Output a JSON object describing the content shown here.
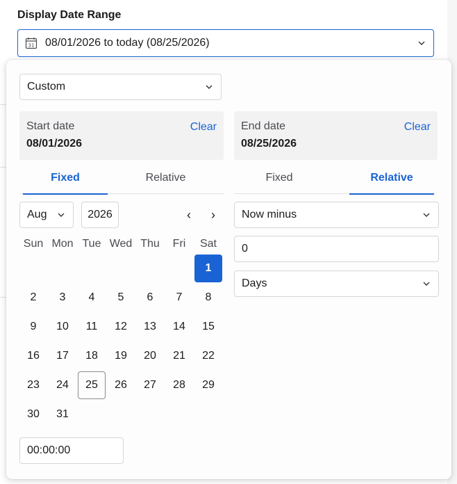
{
  "field": {
    "title": "Display Date Range",
    "value": "08/01/2026 to today (08/25/2026)",
    "calendar_icon_text": "31"
  },
  "preset": {
    "selected": "Custom"
  },
  "start": {
    "caption": "Start date",
    "value": "08/01/2026",
    "clear_label": "Clear",
    "tabs": [
      {
        "label": "Fixed",
        "active": true
      },
      {
        "label": "Relative",
        "active": false
      }
    ],
    "month_select": "Aug",
    "year_input": "2026",
    "weekdays": [
      "Sun",
      "Mon",
      "Tue",
      "Wed",
      "Thu",
      "Fri",
      "Sat"
    ],
    "days": [
      "1",
      "2",
      "3",
      "4",
      "5",
      "6",
      "7",
      "8",
      "9",
      "10",
      "11",
      "12",
      "13",
      "14",
      "15",
      "16",
      "17",
      "18",
      "19",
      "20",
      "21",
      "22",
      "23",
      "24",
      "25",
      "26",
      "27",
      "28",
      "29",
      "30",
      "31"
    ],
    "first_weekday_index": 6,
    "selected_day": "1",
    "today_day": "25",
    "time": "00:00:00",
    "prev_label": "‹",
    "next_label": "›"
  },
  "end": {
    "caption": "End date",
    "value": "08/25/2026",
    "clear_label": "Clear",
    "tabs": [
      {
        "label": "Fixed",
        "active": false
      },
      {
        "label": "Relative",
        "active": true
      }
    ],
    "mode_select": "Now minus",
    "amount": "0",
    "unit_select": "Days"
  },
  "colors": {
    "accent": "#1a63d4",
    "card_bg": "#f2f2f3"
  },
  "icons": {
    "calendar": "calendar-icon",
    "chevron": "chevron-down-icon",
    "prev": "chevron-left-icon",
    "next": "chevron-right-icon"
  }
}
